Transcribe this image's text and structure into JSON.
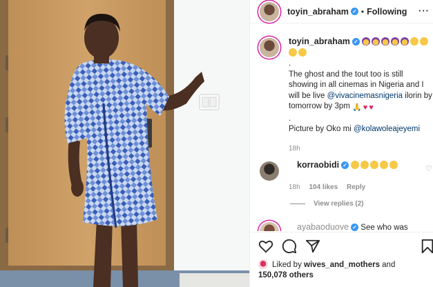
{
  "post": {
    "username": "toyin_abraham",
    "separator": "•",
    "follow_status": "Following",
    "more_icon": "more-horizontal-icon"
  },
  "caption": {
    "username": "toyin_abraham",
    "text_line1": "The ghost and the tout too is still showing in all cinemas in Nigeria and I will be live ",
    "mention1": "@vivacinemasnigeria",
    "text_line2": " ilorin by tomorrow by 3pm",
    "separator": ".",
    "credit_prefix": "Picture by Oko mi ",
    "mention2": "@kolawoleajeyemi",
    "time": "18h"
  },
  "comments": [
    {
      "username": "korraobidi",
      "time": "18h",
      "likes": "104 likes",
      "reply": "Reply",
      "view_replies": "View replies (2)"
    },
    {
      "username": "ayabaoduove",
      "text": "See who was"
    }
  ],
  "likes": {
    "prefix": "Liked by ",
    "liker": "wives_and_mothers",
    "and": " and",
    "count": "150,078 others"
  },
  "icons": {
    "like": "heart-icon",
    "comment": "comment-icon",
    "share": "share-icon",
    "save": "bookmark-icon"
  },
  "colors": {
    "link": "#00376b",
    "verified": "#3897f0",
    "muted": "#8e8e8e",
    "text": "#262626"
  }
}
